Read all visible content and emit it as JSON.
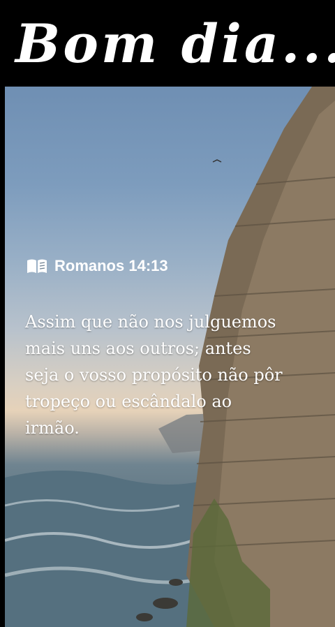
{
  "header": {
    "title": "Bom dia..."
  },
  "verse": {
    "icon": "book-icon",
    "reference": "Romanos 14:13",
    "lines": [
      "Assim que não nos julguemos",
      "mais uns aos outros; antes",
      "seja o vosso propósito não pôr",
      "tropeço ou escândalo ao",
      "irmão."
    ]
  },
  "colors": {
    "text": "#ffffff",
    "header_bg": "#000000",
    "cliff": "#7a6a55",
    "sea": "#5a7080"
  }
}
